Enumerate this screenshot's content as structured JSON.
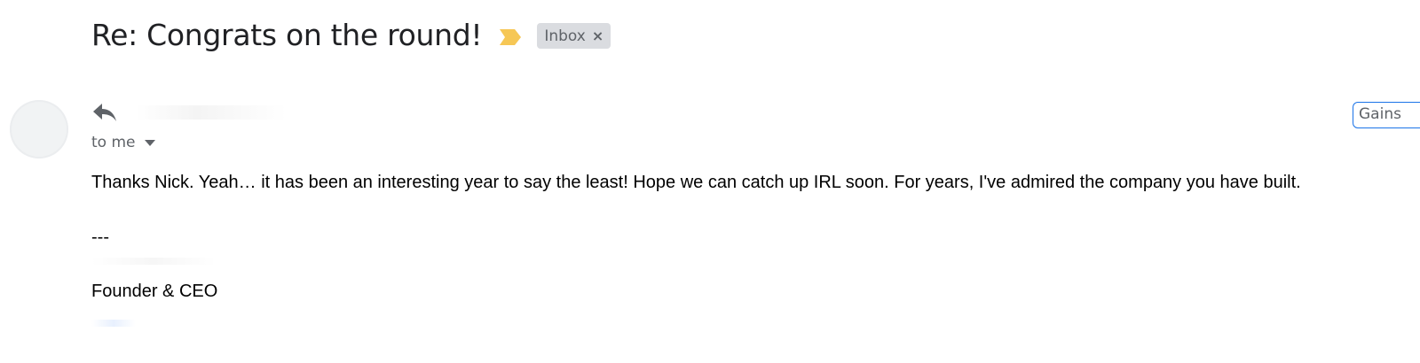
{
  "email": {
    "subject": "Re: Congrats on the round!",
    "label": "Inbox",
    "label_remove_symbol": "×",
    "recipients": "to me",
    "body": "Thanks Nick. Yeah… it has been an interesting year to say the least!  Hope we can catch up IRL soon. For years, I've admired the company you have built.",
    "signature": {
      "separator": "---",
      "title": "Founder & CEO"
    }
  },
  "extension": {
    "label": "Gains"
  },
  "colors": {
    "importance_marker": "#f6c755",
    "accent": "#1a73e8",
    "label_chip_bg": "#dadce0"
  },
  "icons": {
    "importance": "importance-marker-icon",
    "reply": "reply-icon",
    "recipients_toggle": "chevron-down-icon"
  }
}
